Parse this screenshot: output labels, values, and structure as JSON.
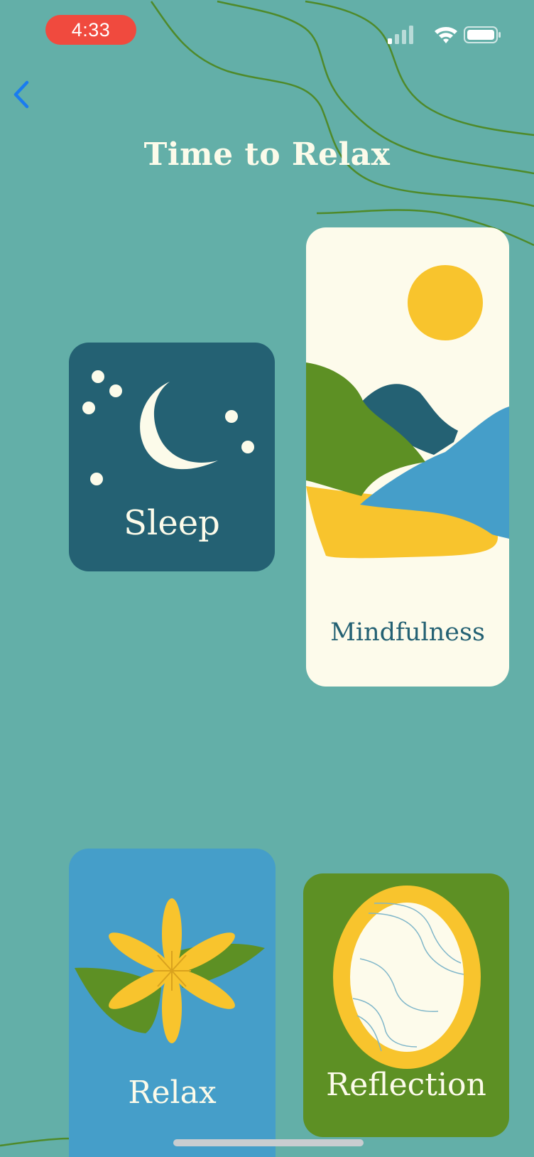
{
  "status_bar": {
    "time": "4:33"
  },
  "nav": {
    "back_icon": "chevron-left-icon"
  },
  "page": {
    "title": "Time to Relax"
  },
  "cards": [
    {
      "label": "Sleep",
      "icon": "moon-stars-illustration",
      "color": "#246173"
    },
    {
      "label": "Mindfulness",
      "icon": "landscape-sun-illustration",
      "color": "#FDFBEB"
    },
    {
      "label": "Relax",
      "icon": "flower-illustration",
      "color": "#459EC9"
    },
    {
      "label": "Reflection",
      "icon": "mirror-illustration",
      "color": "#5D9024"
    }
  ],
  "colors": {
    "background": "#63AFA8",
    "title": "#FCFBEA",
    "accent_yellow": "#F8C42D",
    "accent_green": "#5D9024",
    "accent_blue": "#459EC9",
    "dark_teal": "#246173",
    "time_pill": "#F04A3E"
  }
}
